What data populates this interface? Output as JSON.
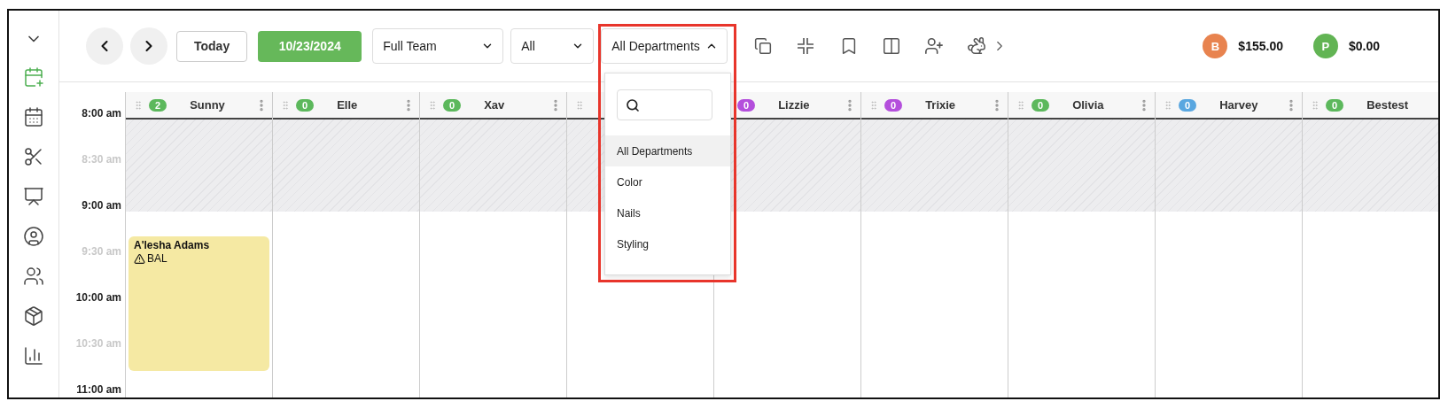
{
  "sidebar": {
    "nav": [
      {
        "selected": true
      },
      {
        "selected": false
      },
      {
        "selected": false
      },
      {
        "selected": false
      },
      {
        "selected": false
      },
      {
        "selected": false
      },
      {
        "selected": false
      },
      {
        "selected": false
      }
    ]
  },
  "toolbar": {
    "today": "Today",
    "date": "10/23/2024",
    "filters": [
      {
        "value": "Full Team",
        "expanded": false
      },
      {
        "value": "All",
        "expanded": false
      },
      {
        "value": "All Departments",
        "expanded": true,
        "options": [
          {
            "label": "All Departments",
            "selected": true
          },
          {
            "label": "Color",
            "selected": false
          },
          {
            "label": "Nails",
            "selected": false
          },
          {
            "label": "Styling",
            "selected": false
          }
        ]
      }
    ]
  },
  "totals": [
    {
      "initial": "B",
      "amount": "$155.00",
      "color": "#e8834f"
    },
    {
      "initial": "P",
      "amount": "$0.00",
      "color": "#62b454"
    }
  ],
  "schedule": {
    "time_labels": [
      {
        "text": "8:00 am",
        "kind": "major"
      },
      {
        "text": "8:30 am",
        "kind": "minor"
      },
      {
        "text": "9:00 am",
        "kind": "major"
      },
      {
        "text": "9:30 am",
        "kind": "minor"
      },
      {
        "text": "10:00 am",
        "kind": "major"
      },
      {
        "text": "10:30 am",
        "kind": "minor"
      },
      {
        "text": "11:00 am",
        "kind": "major"
      }
    ],
    "staff": [
      {
        "kind": "staff",
        "name": "Sunny",
        "count": "2",
        "color": "#5cb85c",
        "appointments": [
          {
            "client": "A'lesha Adams",
            "note": "BAL"
          }
        ]
      },
      {
        "kind": "staff",
        "name": "Elle",
        "count": "0",
        "color": "#5cb85c"
      },
      {
        "kind": "staff",
        "name": "Xav",
        "count": "0",
        "color": "#5cb85c"
      },
      {
        "kind": "covered"
      },
      {
        "kind": "left_covered",
        "name": "Lizzie",
        "count": "0",
        "color": "#b44fdc"
      },
      {
        "kind": "staff",
        "name": "Trixie",
        "count": "0",
        "color": "#b44fdc"
      },
      {
        "kind": "staff",
        "name": "Olivia",
        "count": "0",
        "color": "#5cb85c"
      },
      {
        "kind": "staff",
        "name": "Harvey",
        "count": "0",
        "color": "#5aa7e0"
      },
      {
        "kind": "right_cut",
        "name": "Bestest",
        "count": "0",
        "color": "#5cb85c"
      }
    ]
  }
}
